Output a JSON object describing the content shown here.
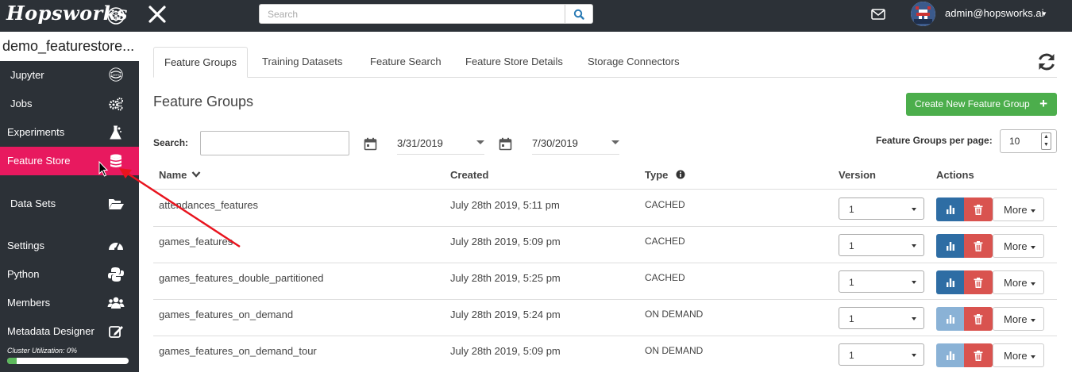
{
  "topbar": {
    "brand": "Hopsworks",
    "search_placeholder": "Search",
    "user_email": "admin@hopsworks.ai"
  },
  "sidebar": {
    "project_name": "demo_featurestore...",
    "items": [
      {
        "label": "Jupyter",
        "icon": "jupyter-icon"
      },
      {
        "label": "Jobs",
        "icon": "gears-icon"
      },
      {
        "label": "Experiments",
        "icon": "flask-icon"
      },
      {
        "label": "Feature Store",
        "icon": "database-icon",
        "active": true
      },
      {
        "label": "Data Sets",
        "icon": "folder-open-icon"
      },
      {
        "label": "Settings",
        "icon": "dashboard-icon"
      },
      {
        "label": "Python",
        "icon": "python-icon"
      },
      {
        "label": "Members",
        "icon": "users-icon"
      },
      {
        "label": "Metadata Designer",
        "icon": "edit-icon"
      }
    ],
    "cluster_label": "Cluster Utilization: 0%",
    "cluster_utilization": 0.08
  },
  "main": {
    "tabs": [
      "Feature Groups",
      "Training Datasets",
      "Feature Search",
      "Feature Store Details",
      "Storage Connectors"
    ],
    "active_tab": "Feature Groups",
    "title": "Feature Groups",
    "create_button": "Create New Feature Group",
    "search_label": "Search:",
    "date_from": "3/31/2019",
    "date_to": "7/30/2019",
    "per_page_label": "Feature Groups per page:",
    "per_page_value": "10",
    "columns": {
      "name": "Name",
      "created": "Created",
      "type": "Type",
      "version": "Version",
      "actions": "Actions"
    },
    "more_label": "More",
    "rows": [
      {
        "name": "attendances_features",
        "created": "July 28th 2019, 5:11 pm",
        "type": "CACHED",
        "version": "1",
        "stats_enabled": true
      },
      {
        "name": "games_features",
        "created": "July 28th 2019, 5:09 pm",
        "type": "CACHED",
        "version": "1",
        "stats_enabled": true
      },
      {
        "name": "games_features_double_partitioned",
        "created": "July 28th 2019, 5:25 pm",
        "type": "CACHED",
        "version": "1",
        "stats_enabled": true
      },
      {
        "name": "games_features_on_demand",
        "created": "July 28th 2019, 5:24 pm",
        "type": "ON DEMAND",
        "version": "1",
        "stats_enabled": false
      },
      {
        "name": "games_features_on_demand_tour",
        "created": "July 28th 2019, 5:09 pm",
        "type": "ON DEMAND",
        "version": "1",
        "stats_enabled": false
      }
    ]
  },
  "colors": {
    "sidebar_bg": "#2c3137",
    "active_pink": "#e8195f",
    "primary_blue": "#2e6da4",
    "danger_red": "#d9534f",
    "success_green": "#4cae4c",
    "annotation_arrow": "#e8141e"
  }
}
